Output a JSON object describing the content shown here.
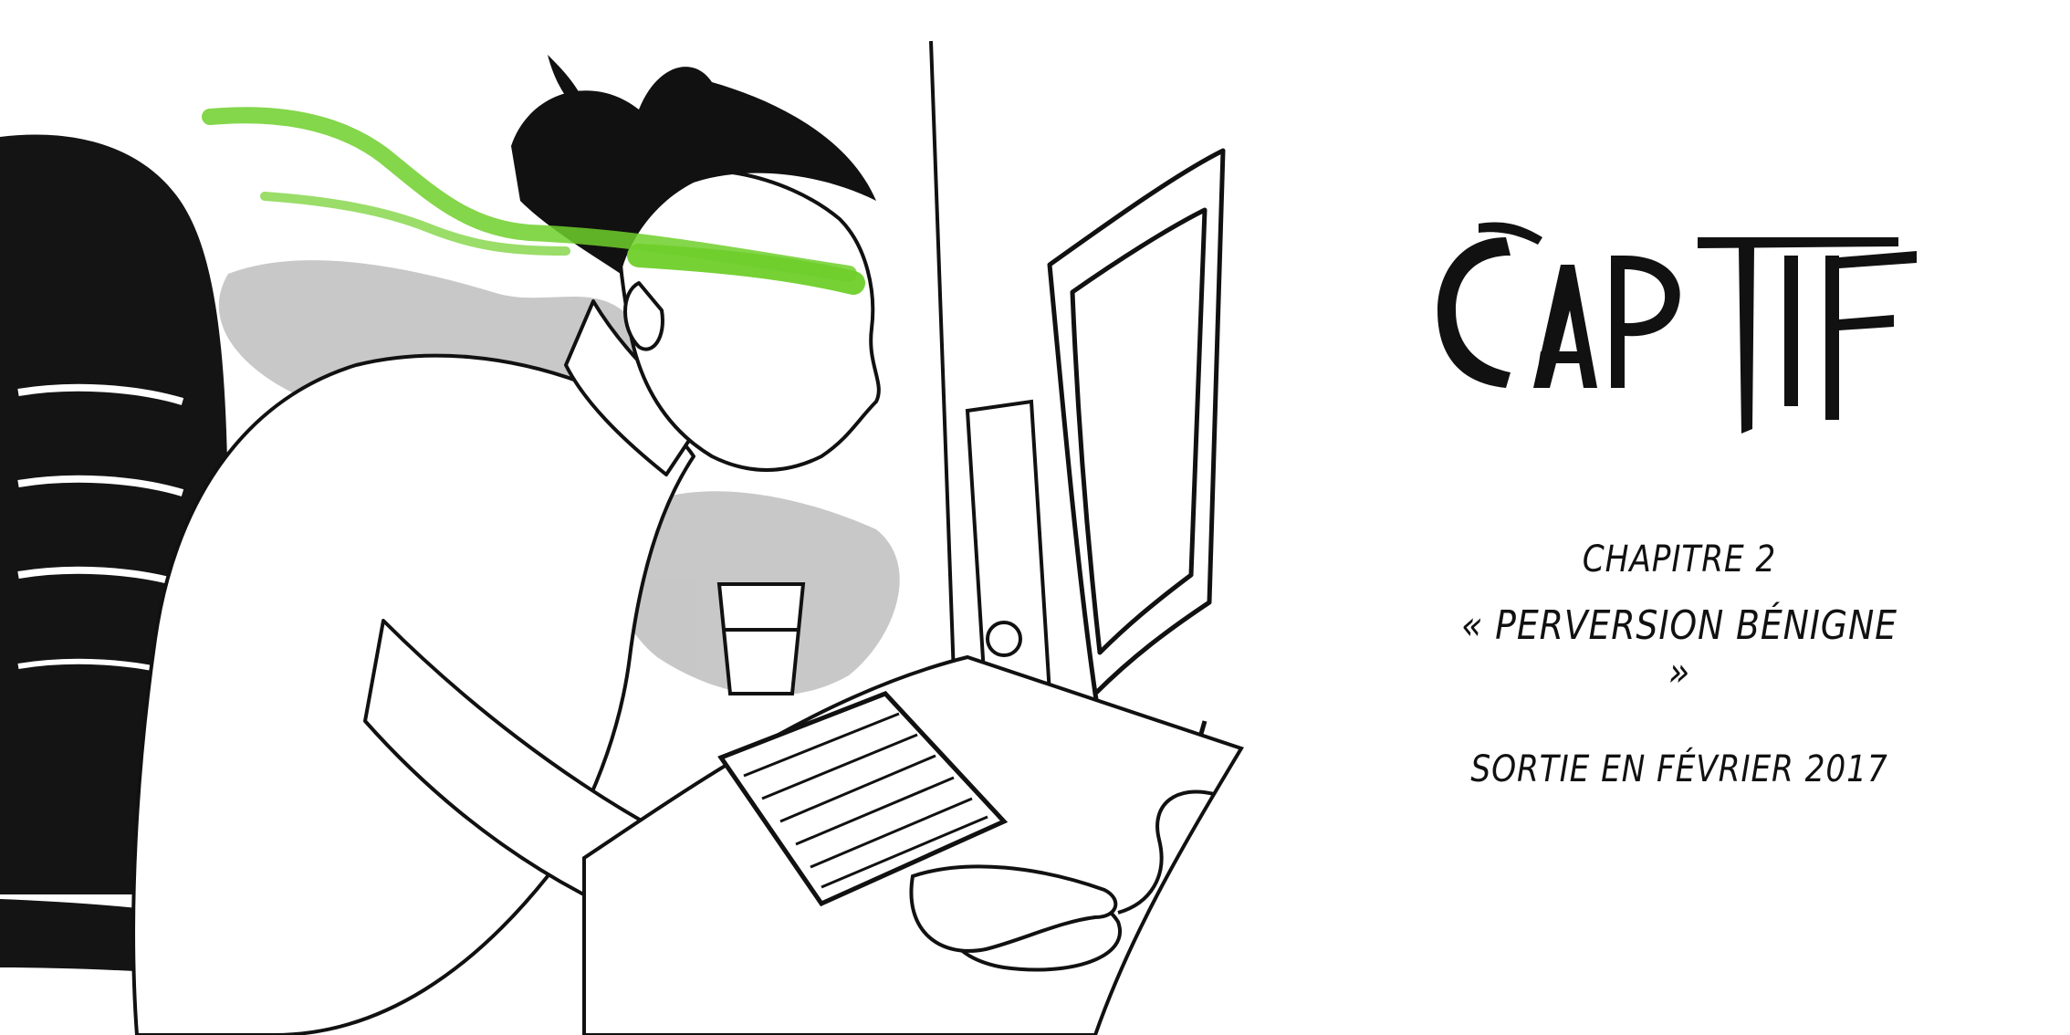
{
  "colors": {
    "ink": "#111111",
    "accent_green": "#6fcf2a",
    "wash_grey": "#9a9a9a",
    "background": "#ffffff"
  },
  "logo": {
    "text": "CAPTIF"
  },
  "chapter": {
    "number": "CHAPITRE 2",
    "title": "« PERVERSION BÉNIGNE »"
  },
  "release": {
    "text": "SORTIE EN FÉVRIER 2017"
  },
  "illustration": {
    "icon": "man-at-computer-illustration"
  }
}
